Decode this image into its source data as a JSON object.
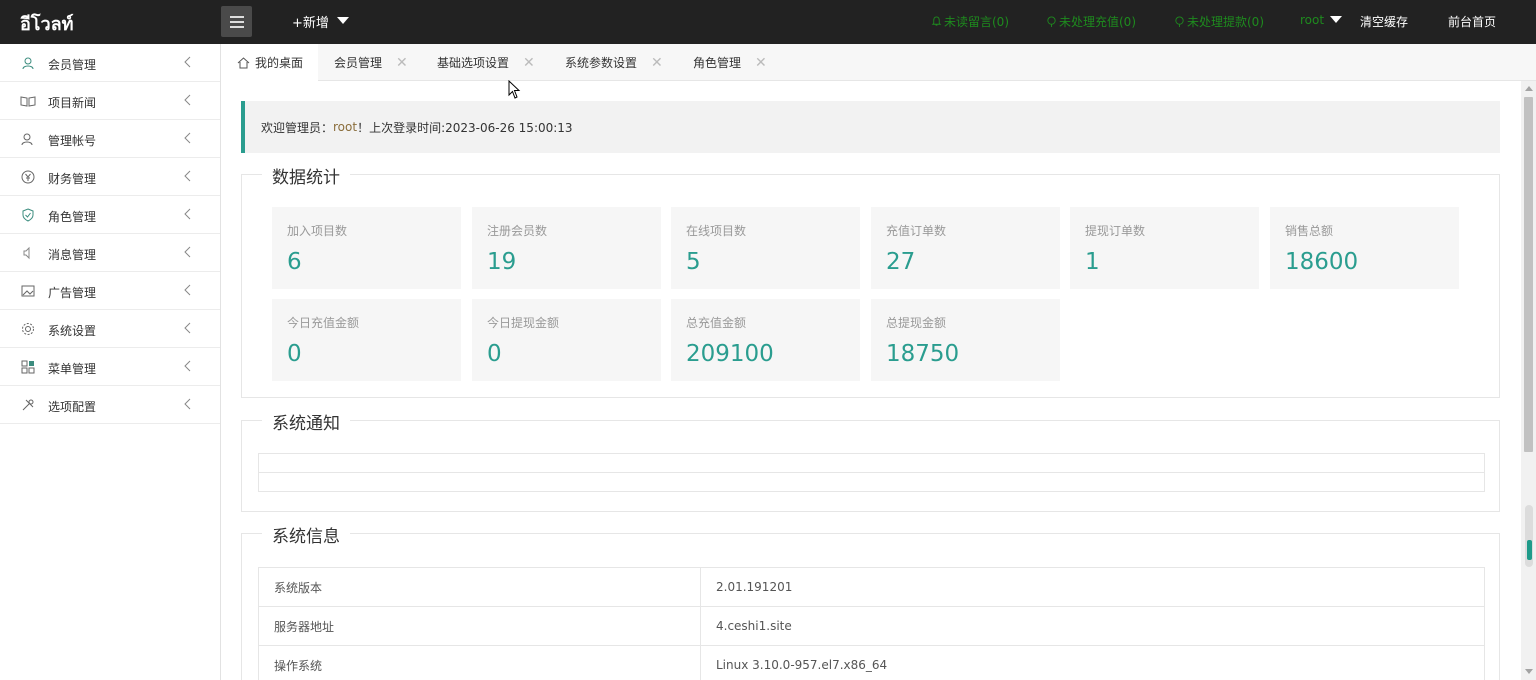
{
  "header": {
    "logo": "อีโวลท์",
    "add_new": "+新增",
    "unread_messages": "未读留言(0)",
    "pending_recharge": "未处理充值(0)",
    "pending_withdraw": "未处理提款(0)",
    "user": "root",
    "clear_cache": "清空缓存",
    "front_home": "前台首页",
    "link_color": "#1e8a1e"
  },
  "sidebar": {
    "items": [
      {
        "label": "会员管理",
        "icon": "user-icon"
      },
      {
        "label": "项目新闻",
        "icon": "book-icon"
      },
      {
        "label": "管理帐号",
        "icon": "admin-icon"
      },
      {
        "label": "财务管理",
        "icon": "yen-icon"
      },
      {
        "label": "角色管理",
        "icon": "shield-icon"
      },
      {
        "label": "消息管理",
        "icon": "speaker-icon"
      },
      {
        "label": "广告管理",
        "icon": "image-icon"
      },
      {
        "label": "系统设置",
        "icon": "gear-icon"
      },
      {
        "label": "菜单管理",
        "icon": "grid-icon"
      },
      {
        "label": "选项配置",
        "icon": "tools-icon"
      }
    ]
  },
  "tabs": [
    {
      "label": "我的桌面",
      "active": true
    },
    {
      "label": "会员管理"
    },
    {
      "label": "基础选项设置"
    },
    {
      "label": "系统参数设置"
    },
    {
      "label": "角色管理"
    }
  ],
  "tab_close_glyph": "✕",
  "welcome": {
    "prefix": "欢迎管理员：",
    "user": "root",
    "suffix": "！上次登录时间:2023-06-26 15:00:13"
  },
  "stats": {
    "title": "数据统计",
    "items": [
      {
        "label": "加入项目数",
        "value": "6"
      },
      {
        "label": "注册会员数",
        "value": "19"
      },
      {
        "label": "在线项目数",
        "value": "5"
      },
      {
        "label": "充值订单数",
        "value": "27"
      },
      {
        "label": "提现订单数",
        "value": "1"
      },
      {
        "label": "销售总额",
        "value": "18600"
      },
      {
        "label": "今日充值金额",
        "value": "0"
      },
      {
        "label": "今日提现金额",
        "value": "0"
      },
      {
        "label": "总充值金额",
        "value": "209100"
      },
      {
        "label": "总提现金额",
        "value": "18750"
      }
    ],
    "accent_color": "#2a9d8f"
  },
  "notice": {
    "title": "系统通知"
  },
  "sysinfo": {
    "title": "系统信息",
    "rows": [
      {
        "key": "系统版本",
        "value": "2.01.191201"
      },
      {
        "key": "服务器地址",
        "value": "4.ceshi1.site"
      },
      {
        "key": "操作系统",
        "value": "Linux 3.10.0-957.el7.x86_64"
      }
    ]
  }
}
